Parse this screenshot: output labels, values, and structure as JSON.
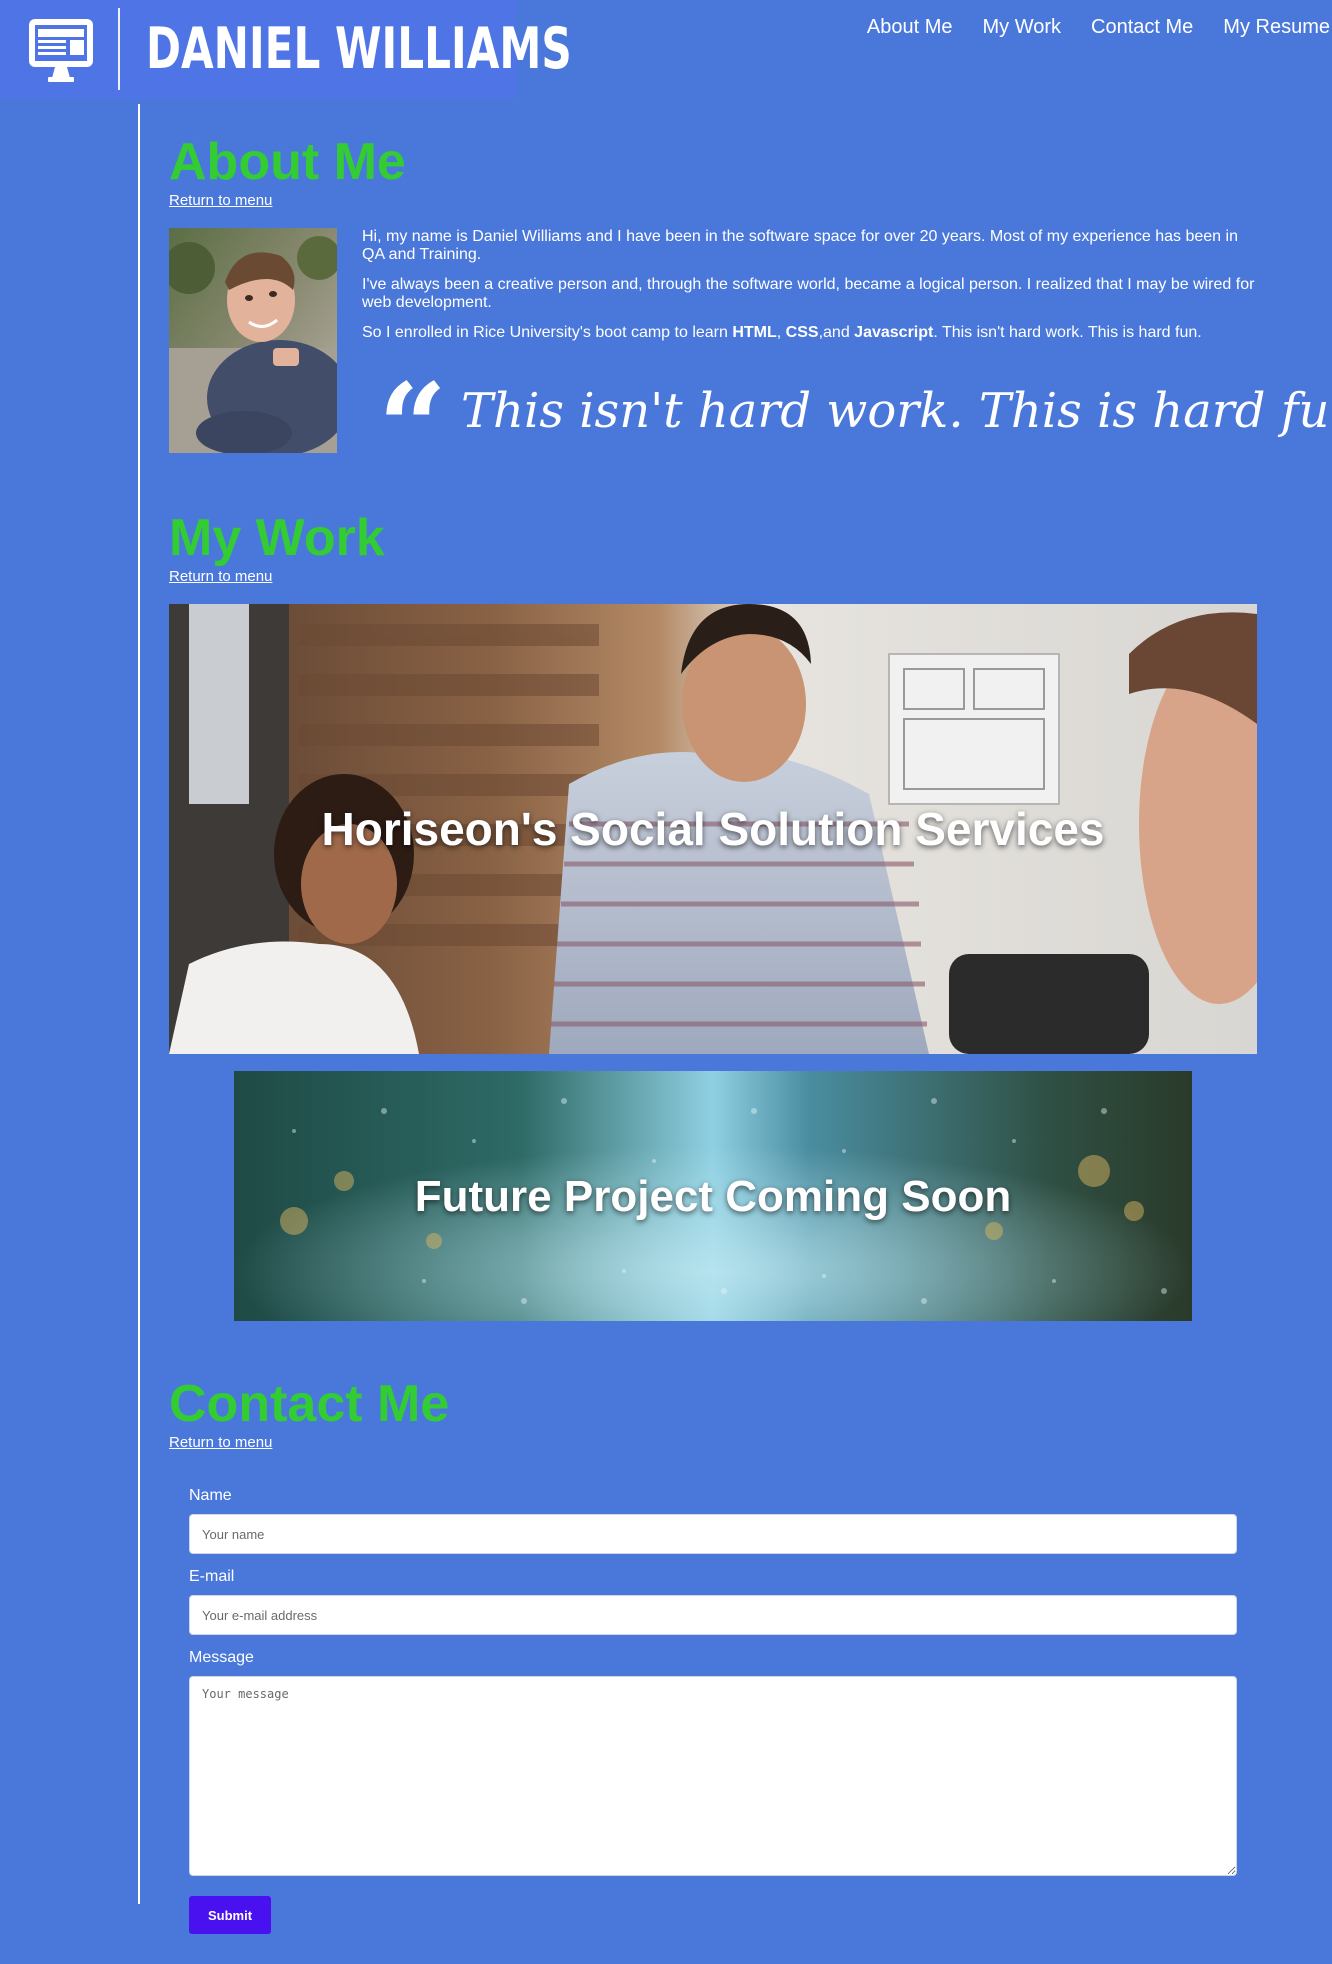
{
  "header": {
    "brand_name": "DANIEL WILLIAMS",
    "brand_icon": "monitor-icon",
    "nav": [
      {
        "label": "About Me"
      },
      {
        "label": "My Work"
      },
      {
        "label": "Contact Me"
      },
      {
        "label": "My Resume"
      }
    ]
  },
  "about": {
    "title": "About Me",
    "return_link": "Return to menu",
    "paragraph1": "Hi, my name is Daniel Williams and I have been in the software space for over 20 years. Most of my experience has been in QA and Training.",
    "paragraph2": "I've always been a creative person and, through the software world, became a logical person. I realized that I may be wired for web development.",
    "paragraph3_prefix": "So I enrolled in Rice University's boot camp to learn ",
    "paragraph3_html": "HTML",
    "paragraph3_sep1": ", ",
    "paragraph3_css": "CSS",
    "paragraph3_sep2": ",and ",
    "paragraph3_js": "Javascript",
    "paragraph3_suffix": ". This isn't hard work. This is hard fun.",
    "quote_mark": "“",
    "quote": "This isn't hard work. This is hard fun."
  },
  "work": {
    "title": "My Work",
    "return_link": "Return to menu",
    "projects": [
      {
        "caption": "Horiseon's Social Solution Services"
      },
      {
        "caption": "Future Project Coming Soon"
      }
    ]
  },
  "contact": {
    "title": "Contact Me",
    "return_link": "Return to menu",
    "name_label": "Name",
    "name_placeholder": "Your name",
    "email_label": "E-mail",
    "email_placeholder": "Your e-mail address",
    "message_label": "Message",
    "message_placeholder": "Your message",
    "submit_label": "Submit"
  },
  "colors": {
    "background": "#4a78da",
    "brand_bg": "#4f74e6",
    "heading": "#33cc33",
    "submit": "#4a11f0"
  }
}
